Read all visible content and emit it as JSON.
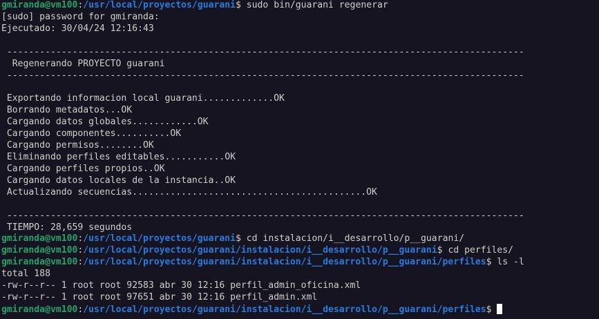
{
  "terminal": {
    "colors": {
      "background": "#171421",
      "foreground": "#d0cfcc",
      "prompt_user": "#26a269",
      "prompt_path": "#2a7bde",
      "cursor": "#ffffff"
    },
    "prompt1": {
      "user": "gmiranda@vm100",
      "sep": ":",
      "path": "/usr/local/proyectos/guarani",
      "symbol": "$ ",
      "command": "sudo bin/guarani regenerar"
    },
    "out": {
      "sudo": "[sudo] password for gmiranda:",
      "ejecutado": "Ejecutado: 30/04/24 12:16:43",
      "blank": "",
      "rule": " -----------------------------------------------------------------------------------------------",
      "title": "  Regenerando PROYECTO guarani",
      "exportando": " Exportando informacion local guarani.............OK",
      "borrando": " Borrando metadatos...OK",
      "globales": " Cargando datos globales............OK",
      "componentes": " Cargando componentes..........OK",
      "permisos": " Cargando permisos........OK",
      "eliminando": " Eliminando perfiles editables...........OK",
      "propios": " Cargando perfiles propios..OK",
      "locales": " Cargando datos locales de la instancia..OK",
      "secuencias": " Actualizando secuencias...........................................OK",
      "tiempo": " TIEMPO: 28,659 segundos"
    },
    "prompt2": {
      "user": "gmiranda@vm100",
      "sep": ":",
      "path": "/usr/local/proyectos/guarani",
      "symbol": "$ ",
      "command": "cd instalacion/i__desarrollo/p__guarani/"
    },
    "prompt3": {
      "user": "gmiranda@vm100",
      "sep": ":",
      "path": "/usr/local/proyectos/guarani/instalacion/i__desarrollo/p__guarani",
      "symbol": "$ ",
      "command": "cd perfiles/"
    },
    "prompt4": {
      "user": "gmiranda@vm100",
      "sep": ":",
      "path": "/usr/local/proyectos/guarani/instalacion/i__desarrollo/p__guarani/perfiles",
      "symbol": "$ ",
      "command": "ls -l"
    },
    "ls": {
      "total": "total 188",
      "file1": "-rw-r--r-- 1 root root 92583 abr 30 12:16 perfil_admin_oficina.xml",
      "file2": "-rw-r--r-- 1 root root 97651 abr 30 12:16 perfil_admin.xml"
    },
    "prompt5": {
      "user": "gmiranda@vm100",
      "sep": ":",
      "path": "/usr/local/proyectos/guarani/instalacion/i__desarrollo/p__guarani/perfiles",
      "symbol": "$ ",
      "command": ""
    }
  }
}
